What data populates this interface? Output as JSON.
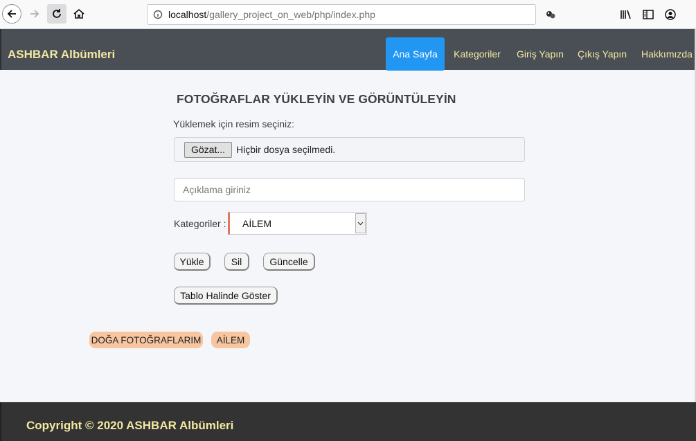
{
  "browser": {
    "url_host": "localhost",
    "url_path": "/gallery_project_on_web/php/index.php"
  },
  "navbar": {
    "brand": "ASHBAR Albümleri",
    "items": [
      {
        "label": "Ana Sayfa",
        "active": true
      },
      {
        "label": "Kategoriler",
        "active": false
      },
      {
        "label": "Giriş Yapın",
        "active": false
      },
      {
        "label": "Çıkış Yapın",
        "active": false
      },
      {
        "label": "Hakkımızda",
        "active": false
      }
    ]
  },
  "main": {
    "title": "FOTOĞRAFLAR YÜKLEYİN VE GÖRÜNTÜLEYİN",
    "upload_label": "Yüklemek için resim seçiniz:",
    "file_button": "Gözat...",
    "file_status": "Hiçbir dosya seçilmedi.",
    "description_placeholder": "Açıklama giriniz",
    "category_label": "Kategoriler :",
    "category_selected": "AİLEM",
    "buttons": {
      "upload": "Yükle",
      "delete": "Sil",
      "update": "Güncelle",
      "table_view": "Tablo Halinde Göster"
    },
    "tags": [
      "DOĞA FOTOĞRAFLARIM",
      "AİLEM"
    ]
  },
  "footer": {
    "text": "Copyright © 2020 ASHBAR Albümleri"
  },
  "colors": {
    "navbar_bg": "#4a4f55",
    "accent_yellow": "#f2e8a1",
    "active_blue": "#2196f3",
    "tag_bg": "#f7c59f",
    "footer_bg": "#333333"
  }
}
